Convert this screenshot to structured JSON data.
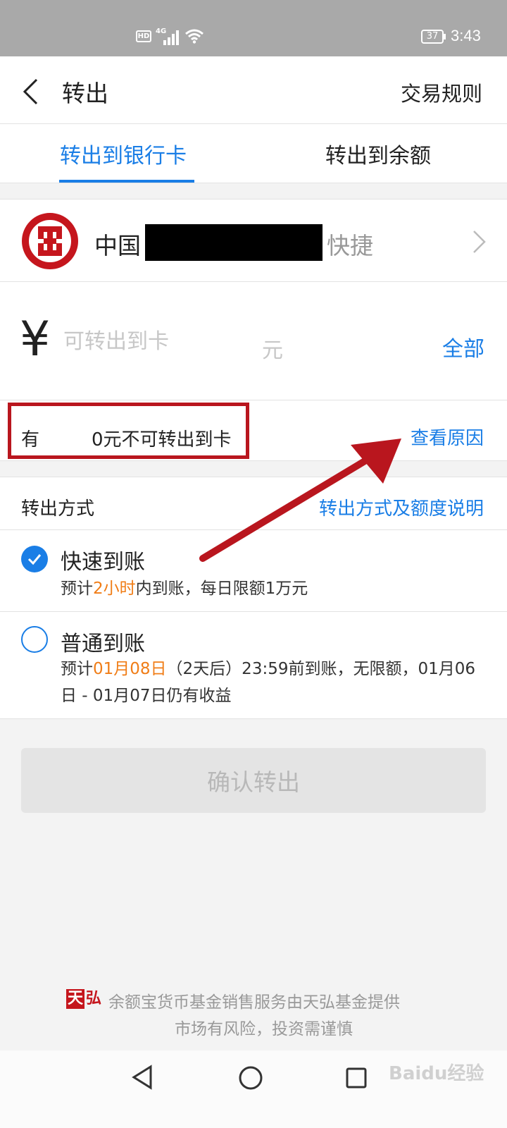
{
  "status_bar": {
    "hd": "HD",
    "network": "4G",
    "battery": "37",
    "time": "3:43"
  },
  "nav": {
    "title": "转出",
    "rules_link": "交易规则"
  },
  "tabs": [
    {
      "label": "转出到银行卡",
      "active": true
    },
    {
      "label": "转出到余额",
      "active": false
    }
  ],
  "bank": {
    "name_prefix": "中国",
    "name_suffix": "快捷"
  },
  "amount": {
    "currency_symbol": "¥",
    "placeholder": "可转出到卡",
    "unit": "元",
    "all_link": "全部"
  },
  "notice": {
    "prefix": "有",
    "suffix": "0元不可转出到卡",
    "reason_link": "查看原因"
  },
  "method": {
    "label": "转出方式",
    "info_link": "转出方式及额度说明"
  },
  "options": {
    "fast": {
      "title": "快速到账",
      "desc_pre": "预计",
      "desc_highlight": "2小时",
      "desc_post": "内到账，每日限额1万元",
      "selected": true
    },
    "normal": {
      "title": "普通到账",
      "desc_pre": "预计",
      "desc_highlight": "01月08日",
      "desc_post": "（2天后）23:59前到账，无限额，01月06日 - 01月07日仍有收益",
      "selected": false
    }
  },
  "confirm_button": "确认转出",
  "footer": {
    "badge_part1": "天",
    "badge_part2": "弘",
    "line1": "余额宝货币基金销售服务由天弘基金提供",
    "line2": "市场有风险，投资需谨慎"
  },
  "watermark": "Baidu经验",
  "colors": {
    "accent": "#1a7ee6",
    "highlight": "#f07d17",
    "annotation": "#b9161e",
    "bank_red": "#c5161d"
  }
}
